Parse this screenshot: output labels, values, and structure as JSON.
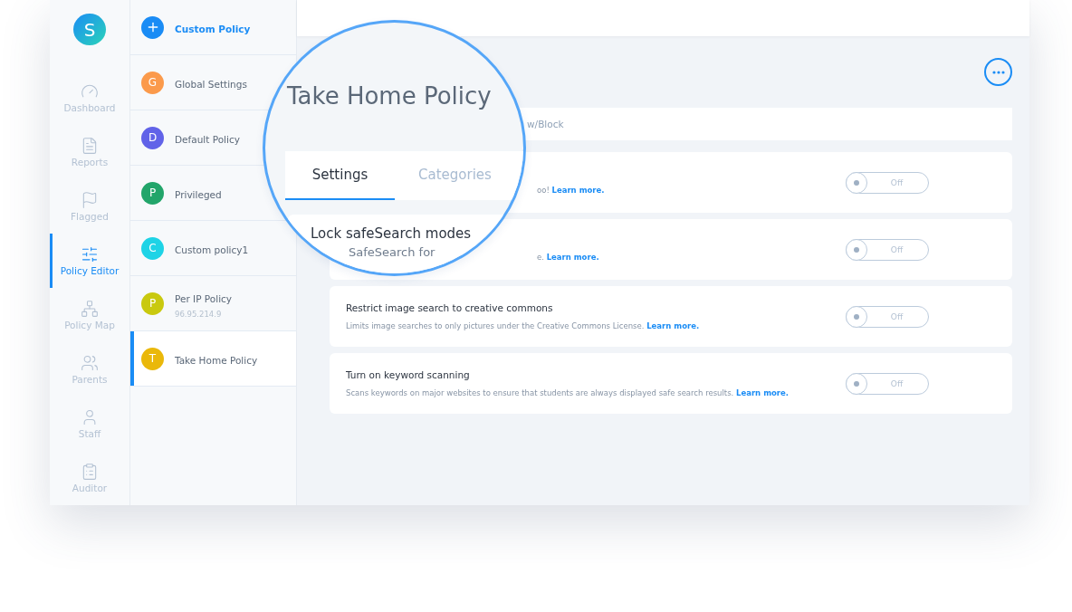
{
  "user_avatar": {
    "letter": "S"
  },
  "nav": [
    {
      "label": "Dashboard",
      "selected": false
    },
    {
      "label": "Reports",
      "selected": false
    },
    {
      "label": "Flagged",
      "selected": false
    },
    {
      "label": "Policy Editor",
      "selected": true
    },
    {
      "label": "Policy Map",
      "selected": false
    },
    {
      "label": "Parents",
      "selected": false
    },
    {
      "label": "Staff",
      "selected": false
    },
    {
      "label": "Auditor",
      "selected": false
    }
  ],
  "policies": [
    {
      "kind": "add",
      "label": "Custom Policy",
      "selected": false
    },
    {
      "kind": "policy",
      "letter": "G",
      "color": "#fb9a4b",
      "label": "Global Settings",
      "selected": false
    },
    {
      "kind": "policy",
      "letter": "D",
      "color": "#6163e8",
      "label": "Default Policy",
      "selected": false
    },
    {
      "kind": "policy",
      "letter": "P",
      "color": "#22a56a",
      "label": "Privileged",
      "selected": false
    },
    {
      "kind": "policy",
      "letter": "C",
      "color": "#1ed3e6",
      "label": "Custom policy1",
      "selected": false
    },
    {
      "kind": "policy",
      "letter": "P",
      "color": "#c9c90f",
      "label": "Per IP Policy",
      "sub": "96.95.214.9",
      "selected": false
    },
    {
      "kind": "policy",
      "letter": "T",
      "color": "#eab80a",
      "label": "Take Home Policy",
      "selected": true
    }
  ],
  "header_bar": {
    "text": "w/Block"
  },
  "cards": [
    {
      "description": "oo!",
      "link": "Learn more.",
      "toggle": {
        "on": false,
        "label": "Off"
      }
    },
    {
      "description": "e.",
      "link": "Learn more.",
      "toggle": {
        "on": false,
        "label": "Off"
      }
    },
    {
      "title": "Restrict image search to creative commons",
      "description": "Limits image searches to only pictures under the Creative Commons License.",
      "link": "Learn more.",
      "toggle": {
        "on": false,
        "label": "Off"
      }
    },
    {
      "title": "Turn on keyword scanning",
      "description": "Scans keywords on major websites to ensure that students are always displayed safe search results.",
      "link": "Learn more.",
      "toggle": {
        "on": false,
        "label": "Off"
      }
    }
  ],
  "magnifier": {
    "title": "Take Home Policy",
    "tabs": [
      {
        "label": "Settings",
        "selected": true
      },
      {
        "label": "Categories",
        "selected": false
      }
    ],
    "card_title": "Lock safeSearch modes",
    "card_subtitle": "SafeSearch for"
  }
}
